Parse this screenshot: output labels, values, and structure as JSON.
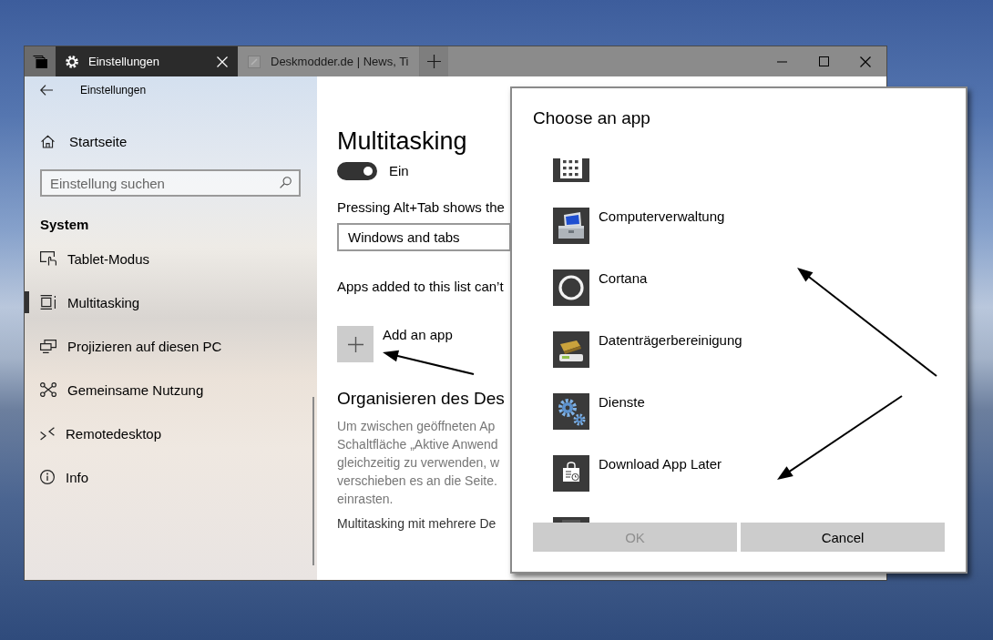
{
  "window": {
    "tabs": [
      {
        "label": "Einstellungen",
        "selected": true
      },
      {
        "label": "Deskmodder.de | News, Ti",
        "selected": false
      }
    ]
  },
  "sidebar": {
    "header": "Einstellungen",
    "home": "Startseite",
    "search": {
      "placeholder": "Einstellung suchen"
    },
    "section": "System",
    "items": [
      {
        "label": "Tablet-Modus",
        "selected": false
      },
      {
        "label": "Multitasking",
        "selected": true
      },
      {
        "label": "Projizieren auf diesen PC",
        "selected": false
      },
      {
        "label": "Gemeinsame Nutzung",
        "selected": false
      },
      {
        "label": "Remotedesktop",
        "selected": false
      },
      {
        "label": "Info",
        "selected": false
      }
    ]
  },
  "content": {
    "title": "Multitasking",
    "toggle": {
      "on": true,
      "label": "Ein"
    },
    "alt_tab": {
      "label": "Pressing Alt+Tab shows the",
      "value": "Windows and tabs"
    },
    "apps_note": "Apps added to this list can’t",
    "add_app": "Add an app",
    "section": {
      "title": "Organisieren des Des",
      "lines": [
        "Um zwischen geöffneten Ap",
        "Schaltfläche „Aktive Anwend",
        "gleichzeitig zu verwenden, w",
        "verschieben es an die Seite.",
        "einrasten."
      ],
      "link": "Multitasking mit mehrere De"
    }
  },
  "dialog": {
    "title": "Choose an app",
    "apps": [
      {
        "kind": "clipped"
      },
      {
        "kind": "app",
        "label": "Computerverwaltung"
      },
      {
        "kind": "app",
        "label": "Cortana"
      },
      {
        "kind": "app",
        "label": "Datenträgerbereinigung"
      },
      {
        "kind": "app",
        "label": "Dienste"
      },
      {
        "kind": "app",
        "label": "Download App Later"
      },
      {
        "kind": "clipped"
      }
    ],
    "buttons": [
      {
        "label": "OK",
        "disabled": true
      },
      {
        "label": "Cancel",
        "disabled": false
      }
    ]
  }
}
